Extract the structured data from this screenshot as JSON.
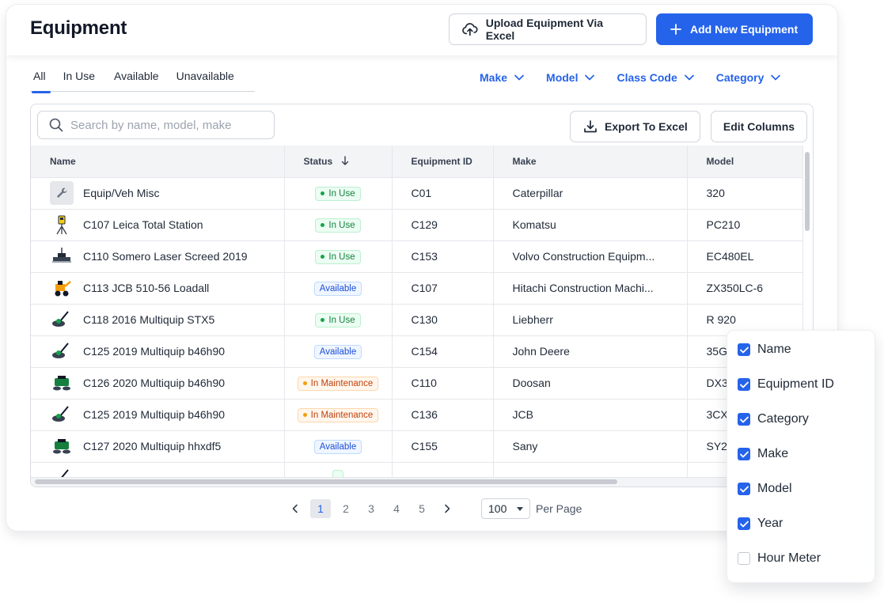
{
  "header": {
    "title": "Equipment",
    "upload_label": "Upload Equipment Via Excel",
    "add_label": "Add New Equipment"
  },
  "tabs": [
    {
      "label": "All",
      "active": true
    },
    {
      "label": "In Use",
      "active": false
    },
    {
      "label": "Available",
      "active": false
    },
    {
      "label": "Unavailable",
      "active": false
    }
  ],
  "filters": [
    "Make",
    "Model",
    "Class Code",
    "Category"
  ],
  "toolbar": {
    "search_placeholder": "Search by name, model, make",
    "export_label": "Export To Excel",
    "edit_columns_label": "Edit Columns"
  },
  "table": {
    "columns": [
      "Name",
      "Status",
      "Equipment ID",
      "Make",
      "Model"
    ],
    "rows": [
      {
        "name": "Equip/Veh Misc",
        "status": "In Use",
        "id": "C01",
        "make": "Caterpillar",
        "model": "320"
      },
      {
        "name": "C107 Leica Total Station",
        "status": "In Use",
        "id": "C129",
        "make": "Komatsu",
        "model": "PC210"
      },
      {
        "name": "C110 Somero Laser Screed 2019",
        "status": "In Use",
        "id": "C153",
        "make": "Volvo Construction Equipm...",
        "model": "EC480EL"
      },
      {
        "name": "C113 JCB 510-56 Loadall",
        "status": "Available",
        "id": "C107",
        "make": "Hitachi Construction Machi...",
        "model": "ZX350LC-6"
      },
      {
        "name": "C118  2016 Multiquip STX5",
        "status": "In Use",
        "id": "C130",
        "make": "Liebherr",
        "model": "R 920"
      },
      {
        "name": "C125  2019 Multiquip b46h90",
        "status": "Available",
        "id": "C154",
        "make": "John Deere",
        "model": "35G"
      },
      {
        "name": "C126  2020 Multiquip b46h90",
        "status": "In Maintenance",
        "id": "C110",
        "make": "Doosan",
        "model": "DX3"
      },
      {
        "name": "C125  2019 Multiquip b46h90",
        "status": "In Maintenance",
        "id": "C136",
        "make": "JCB",
        "model": "3CX"
      },
      {
        "name": "C127  2020 Multiquip hhxdf5",
        "status": "Available",
        "id": "C155",
        "make": "Sany",
        "model": "SY2"
      }
    ]
  },
  "pagination": {
    "pages": [
      "1",
      "2",
      "3",
      "4",
      "5"
    ],
    "current": "1",
    "per_page": "100",
    "per_page_label": "Per Page"
  },
  "column_options": [
    {
      "label": "Name",
      "checked": true
    },
    {
      "label": "Equipment ID",
      "checked": true
    },
    {
      "label": "Category",
      "checked": true
    },
    {
      "label": "Make",
      "checked": true
    },
    {
      "label": "Model",
      "checked": true
    },
    {
      "label": "Year",
      "checked": true
    },
    {
      "label": "Hour Meter",
      "checked": false
    }
  ],
  "colors": {
    "accent": "#2563eb",
    "in_use": "#16a34a",
    "available": "#1d4ed8",
    "maintenance": "#c2410c"
  }
}
